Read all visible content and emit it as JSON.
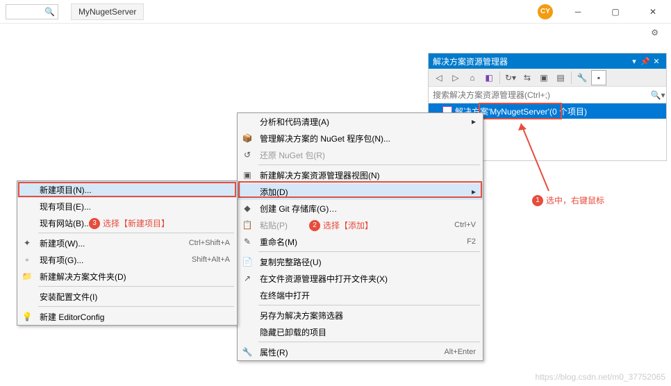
{
  "titlebar": {
    "project_name": "MyNugetServer",
    "avatar": "CY"
  },
  "panel": {
    "title": "解决方案资源管理器",
    "search_placeholder": "搜索解决方案资源管理器(Ctrl+;)",
    "solution_text": "解决方案'MyNugetServer'(0 个项目)"
  },
  "menu1": {
    "items": [
      {
        "icon": "",
        "label": "分析和代码清理(A)",
        "arrow": true
      },
      {
        "icon": "📦",
        "label": "管理解决方案的 NuGet 程序包(N)..."
      },
      {
        "icon": "↺",
        "label": "还原 NuGet 包(R)",
        "disabled": true
      },
      {
        "sep": true
      },
      {
        "icon": "▣",
        "label": "新建解决方案资源管理器视图(N)"
      },
      {
        "icon": "",
        "label": "添加(D)",
        "arrow": true,
        "highlight": true
      },
      {
        "icon": "◆",
        "label": "创建 Git 存储库(G)…"
      },
      {
        "icon": "📋",
        "label": "粘贴(P)",
        "shortcut": "Ctrl+V",
        "disabled": true
      },
      {
        "icon": "✎",
        "label": "重命名(M)",
        "shortcut": "F2"
      },
      {
        "sep": true
      },
      {
        "icon": "📄",
        "label": "复制完整路径(U)"
      },
      {
        "icon": "↗",
        "label": "在文件资源管理器中打开文件夹(X)"
      },
      {
        "icon": "",
        "label": "在终端中打开"
      },
      {
        "sep": true
      },
      {
        "icon": "",
        "label": "另存为解决方案筛选器"
      },
      {
        "icon": "",
        "label": "隐藏已卸载的项目"
      },
      {
        "sep": true
      },
      {
        "icon": "🔧",
        "label": "属性(R)",
        "shortcut": "Alt+Enter"
      }
    ]
  },
  "menu2": {
    "items": [
      {
        "icon": "",
        "label": "新建项目(N)...",
        "highlight": true
      },
      {
        "icon": "",
        "label": "现有项目(E)..."
      },
      {
        "icon": "",
        "label": "现有网站(B)..."
      },
      {
        "sep": true
      },
      {
        "icon": "✦",
        "label": "新建项(W)...",
        "shortcut": "Ctrl+Shift+A"
      },
      {
        "icon": "▫",
        "label": "现有项(G)...",
        "shortcut": "Shift+Alt+A"
      },
      {
        "icon": "📁",
        "label": "新建解决方案文件夹(D)"
      },
      {
        "sep": true
      },
      {
        "icon": "",
        "label": "安装配置文件(I)"
      },
      {
        "sep": true
      },
      {
        "icon": "💡",
        "label": "新建 EditorConfig"
      }
    ]
  },
  "annotations": {
    "a1": "选中，右键鼠标",
    "a2": "选择【添加】",
    "a3": "选择【新建项目】"
  },
  "watermark": "https://blog.csdn.net/m0_37752065"
}
